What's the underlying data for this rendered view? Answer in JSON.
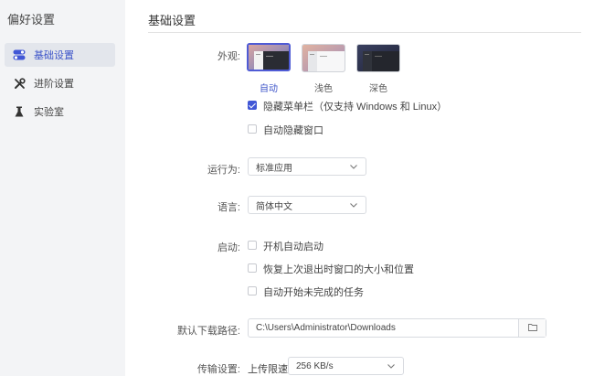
{
  "sidebar": {
    "title": "偏好设置",
    "items": [
      {
        "label": "基础设置",
        "icon": "toggle-icon"
      },
      {
        "label": "进阶设置",
        "icon": "tools-icon"
      },
      {
        "label": "实验室",
        "icon": "flask-icon"
      }
    ]
  },
  "main": {
    "title": "基础设置",
    "appearance": {
      "label": "外观:",
      "options": [
        {
          "label": "自动",
          "selected": true
        },
        {
          "label": "浅色",
          "selected": false
        },
        {
          "label": "深色",
          "selected": false
        }
      ],
      "hide_menubar": {
        "label": "隐藏菜单栏（仅支持 Windows 和 Linux）",
        "checked": true
      },
      "auto_hide_window": {
        "label": "自动隐藏窗口",
        "checked": false
      }
    },
    "run_as": {
      "label": "运行为:",
      "value": "标准应用"
    },
    "language": {
      "label": "语言:",
      "value": "简体中文"
    },
    "startup": {
      "label": "启动:",
      "options": [
        {
          "label": "开机自动启动",
          "checked": false
        },
        {
          "label": "恢复上次退出时窗口的大小和位置",
          "checked": false
        },
        {
          "label": "自动开始未完成的任务",
          "checked": false
        }
      ]
    },
    "download_path": {
      "label": "默认下载路径:",
      "value": "C:\\Users\\Administrator\\Downloads"
    },
    "transfer": {
      "label": "传输设置:",
      "upload_limit_label": "上传限速",
      "upload_limit_value": "256 KB/s"
    }
  },
  "colors": {
    "accent": "#4157d6",
    "sidebar_bg": "#f3f4f6",
    "active_bg": "#e3e6ec"
  }
}
